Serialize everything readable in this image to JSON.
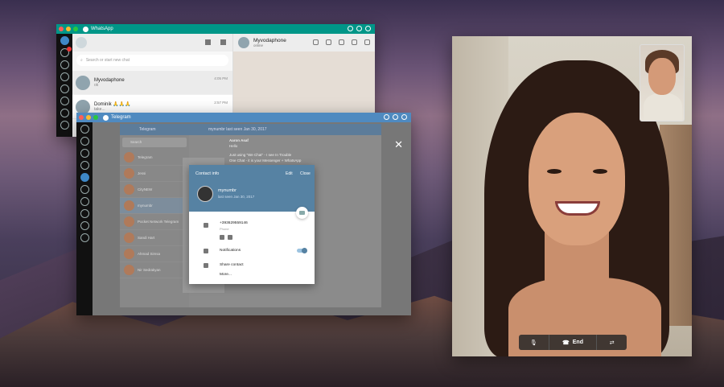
{
  "whatsapp": {
    "title": "WhatsApp",
    "search_placeholder": "Search or start new chat",
    "chats": [
      {
        "name": "Myvodaphone",
        "sub": "ok",
        "time": "4:05 PM"
      },
      {
        "name": "Dominik 🙏🙏🙏",
        "sub": "take...",
        "time": "2:57 PM"
      }
    ],
    "active_chat": {
      "name": "Myvodaphone",
      "status": "online"
    }
  },
  "telegram": {
    "title": "Telegram",
    "header_left": "Telegram",
    "header_user": "mynumbr",
    "header_seen": "last seen Jan 30, 2017",
    "search_placeholder": "Search",
    "list": [
      "Telegram",
      "Jessi",
      "CityNEW",
      "mynumbr",
      "Pocket Network Telegram",
      "Sandi Hart",
      "Ahmad Simsa",
      "Nir Sedrakyan"
    ],
    "message_author": "Aaron Asaf",
    "message_text": "Hello",
    "message_2": "Just using \"We Chat\" - I see In Trouble",
    "message_3": "One Chat - it is your Messenger + WhatsApp",
    "contact_info": {
      "title": "Contact info",
      "edit": "Edit",
      "close": "Close",
      "name": "mynumbr",
      "seen": "last seen Jan 30, 2017",
      "phone": "+393629559146",
      "phone_label": "Phone",
      "notifications": "Notifications",
      "share": "Share contact",
      "more": "More..."
    },
    "close_x": "✕"
  },
  "facetime": {
    "end_label": "End",
    "mute_icon": "mic-mute-icon",
    "flip_icon": "camera-flip-icon"
  }
}
